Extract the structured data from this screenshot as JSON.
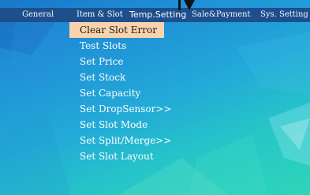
{
  "menubar": {
    "items": [
      {
        "label": "General"
      },
      {
        "label": "Item & Slot"
      },
      {
        "label": "Temp.Setting"
      },
      {
        "label": "Sale&Payment"
      },
      {
        "label": "Sys. Setting"
      }
    ]
  },
  "dropdown": {
    "items": [
      {
        "label": "Clear Slot Error"
      },
      {
        "label": "Test Slots"
      },
      {
        "label": "Set Price"
      },
      {
        "label": "Set Stock"
      },
      {
        "label": "Set Capacity"
      },
      {
        "label": "Set DropSensor>>"
      },
      {
        "label": "Set Slot Mode"
      },
      {
        "label": "Set Split/Merge>>"
      },
      {
        "label": "Set Slot Layout"
      }
    ]
  },
  "colors": {
    "menubar_bg": "#1d4f8d",
    "selected_bg": "#f9d3ad",
    "text": "#ffffff"
  }
}
